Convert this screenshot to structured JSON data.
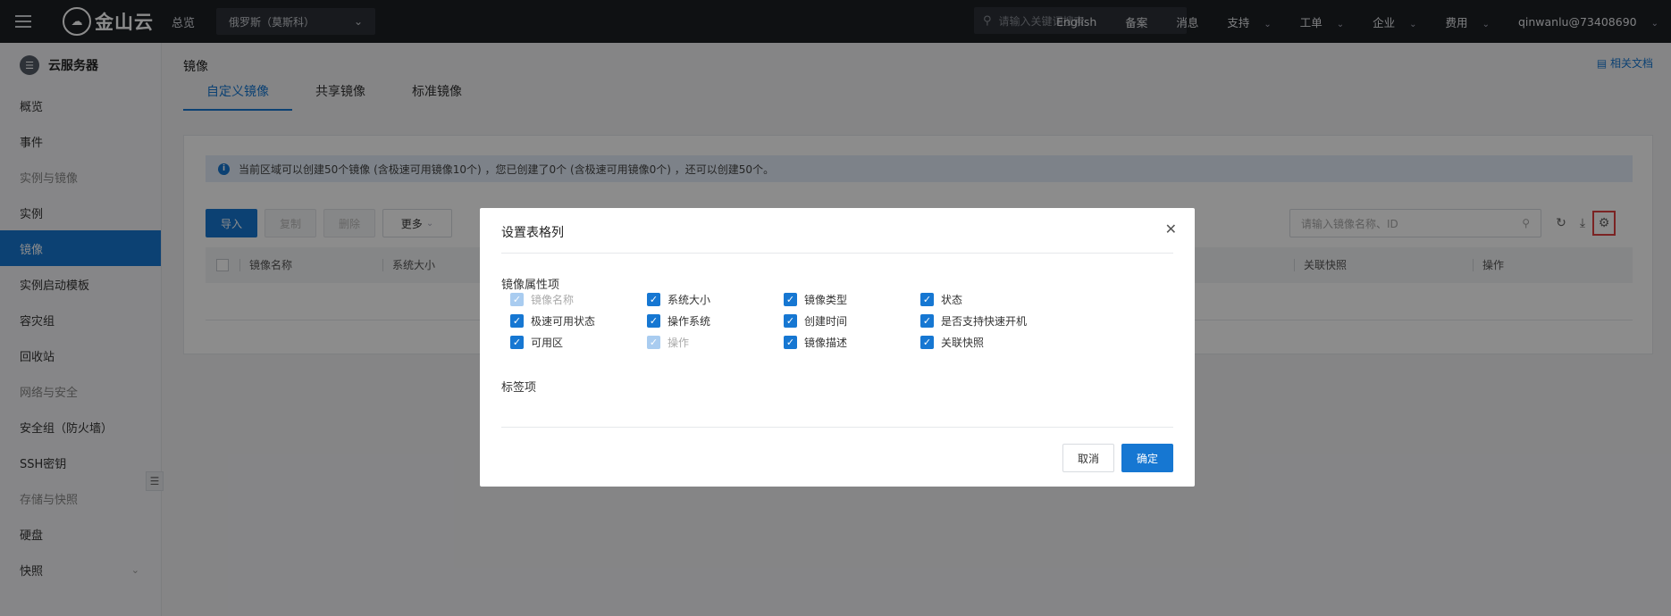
{
  "topbar": {
    "logo_text": "金山云",
    "overview": "总览",
    "region": "俄罗斯（莫斯科）",
    "search_placeholder": "请输入关键词搜索",
    "links": [
      {
        "label": "English",
        "has_chevron": false
      },
      {
        "label": "备案",
        "has_chevron": false
      },
      {
        "label": "消息",
        "has_chevron": false
      },
      {
        "label": "支持",
        "has_chevron": true
      },
      {
        "label": "工单",
        "has_chevron": true
      },
      {
        "label": "企业",
        "has_chevron": true
      },
      {
        "label": "费用",
        "has_chevron": true
      },
      {
        "label": "qinwanlu@73408690",
        "has_chevron": true
      }
    ]
  },
  "sidebar": {
    "title": "云服务器",
    "items": [
      {
        "label": "概览",
        "state": "normal"
      },
      {
        "label": "事件",
        "state": "normal"
      },
      {
        "label": "实例与镜像",
        "state": "grey"
      },
      {
        "label": "实例",
        "state": "normal"
      },
      {
        "label": "镜像",
        "state": "active"
      },
      {
        "label": "实例启动模板",
        "state": "normal"
      },
      {
        "label": "容灾组",
        "state": "normal"
      },
      {
        "label": "回收站",
        "state": "normal"
      },
      {
        "label": "网络与安全",
        "state": "grey"
      },
      {
        "label": "安全组（防火墙）",
        "state": "normal"
      },
      {
        "label": "SSH密钥",
        "state": "normal"
      },
      {
        "label": "存储与快照",
        "state": "grey"
      },
      {
        "label": "硬盘",
        "state": "normal"
      },
      {
        "label": "快照",
        "state": "normal"
      }
    ]
  },
  "main": {
    "page_title": "镜像",
    "doc_link": "相关文档",
    "tabs": [
      "自定义镜像",
      "共享镜像",
      "标准镜像"
    ],
    "info_text": "当前区域可以创建50个镜像 (含极速可用镜像10个) ，您已创建了0个 (含极速可用镜像0个) ，还可以创建50个。",
    "buttons": {
      "import": "导入",
      "copy": "复制",
      "delete": "删除",
      "more": "更多"
    },
    "search_placeholder": "请输入镜像名称、ID",
    "columns_left": [
      "镜像名称",
      "系统大小"
    ],
    "columns_right": [
      "关联快照",
      "操作"
    ]
  },
  "modal": {
    "title": "设置表格列",
    "section_attributes": "镜像属性项",
    "rows": [
      [
        {
          "label": "镜像名称",
          "checked": true,
          "disabled": true
        },
        {
          "label": "系统大小",
          "checked": true,
          "disabled": false
        },
        {
          "label": "镜像类型",
          "checked": true,
          "disabled": false
        },
        {
          "label": "状态",
          "checked": true,
          "disabled": false
        }
      ],
      [
        {
          "label": "极速可用状态",
          "checked": true,
          "disabled": false
        },
        {
          "label": "操作系统",
          "checked": true,
          "disabled": false
        },
        {
          "label": "创建时间",
          "checked": true,
          "disabled": false
        },
        {
          "label": "是否支持快速开机",
          "checked": true,
          "disabled": false
        }
      ],
      [
        {
          "label": "可用区",
          "checked": true,
          "disabled": false
        },
        {
          "label": "操作",
          "checked": true,
          "disabled": true
        },
        {
          "label": "镜像描述",
          "checked": true,
          "disabled": false
        },
        {
          "label": "关联快照",
          "checked": true,
          "disabled": false
        }
      ]
    ],
    "section_tags": "标签项",
    "cancel": "取消",
    "ok": "确定"
  }
}
